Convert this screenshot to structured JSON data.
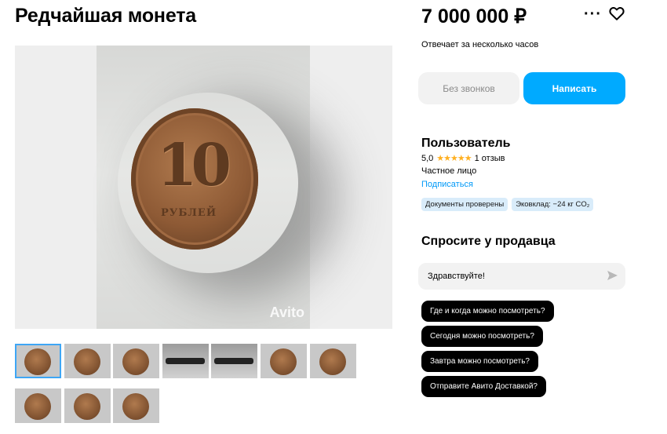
{
  "listing": {
    "title": "Редчайшая монета",
    "price": "7 000 000 ₽",
    "photo_watermark": "Avito",
    "coin": {
      "denomination": "10",
      "legend": "РУБЛЕЙ"
    },
    "thumbnails_count": 10,
    "selected_thumbnail": 1
  },
  "actions": {
    "response_time": "Отвечает за несколько часов",
    "no_calls_label": "Без звонков",
    "write_label": "Написать"
  },
  "seller": {
    "name": "Пользователь",
    "rating": "5,0",
    "stars": "★★★★★",
    "reviews": "1 отзыв",
    "type": "Частное лицо",
    "subscribe": "Подписаться",
    "badges": [
      "Документы проверены",
      "Эковклад: −24 кг CO₂"
    ]
  },
  "ask": {
    "title": "Спросите у продавца",
    "message_value": "Здравствуйте!",
    "quick_questions": [
      "Где и когда можно посмотреть?",
      "Сегодня можно посмотреть?",
      "Завтра можно посмотреть?",
      "Отправите Авито Доставкой?"
    ]
  },
  "colors": {
    "accent": "#00aaff",
    "link": "#0099f7",
    "star": "#ffb021",
    "badge_bg": "#d9ecfa"
  }
}
